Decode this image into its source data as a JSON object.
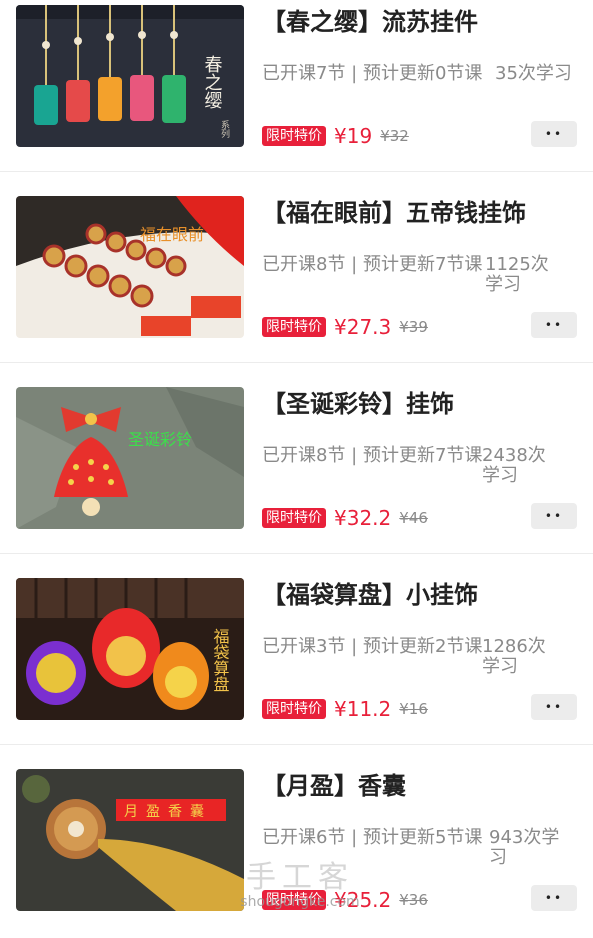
{
  "courses": [
    {
      "title": "【春之缨】流苏挂件",
      "meta": "已开课7节 | 预计更新0节课",
      "students": "35次学习",
      "badge": "限时特价",
      "price": "¥19",
      "old_price": "¥32",
      "more_icon": "••",
      "thumb_text": "春之缨",
      "thumb_sub": "系列"
    },
    {
      "title": "【福在眼前】五帝钱挂饰",
      "meta": "已开课8节 | 预计更新7节课",
      "students": "1125次学习",
      "badge": "限时特价",
      "price": "¥27.3",
      "old_price": "¥39",
      "more_icon": "••",
      "thumb_text": "福在眼前"
    },
    {
      "title": "【圣诞彩铃】挂饰",
      "meta": "已开课8节 | 预计更新7节课",
      "students": "2438次学习",
      "badge": "限时特价",
      "price": "¥32.2",
      "old_price": "¥46",
      "more_icon": "••",
      "thumb_text": "圣诞彩铃"
    },
    {
      "title": "【福袋算盘】小挂饰",
      "meta": "已开课3节 | 预计更新2节课",
      "students": "1286次学习",
      "badge": "限时特价",
      "price": "¥11.2",
      "old_price": "¥16",
      "more_icon": "••",
      "thumb_text": "福袋算盘"
    },
    {
      "title": "【月盈】香囊",
      "meta": "已开课6节 | 预计更新5节课",
      "students": "943次学习",
      "badge": "限时特价",
      "price": "¥25.2",
      "old_price": "¥36",
      "more_icon": "••",
      "thumb_text": "月盈香囊"
    }
  ],
  "watermark": {
    "cn": "手工客",
    "en": "shougongke.com"
  }
}
